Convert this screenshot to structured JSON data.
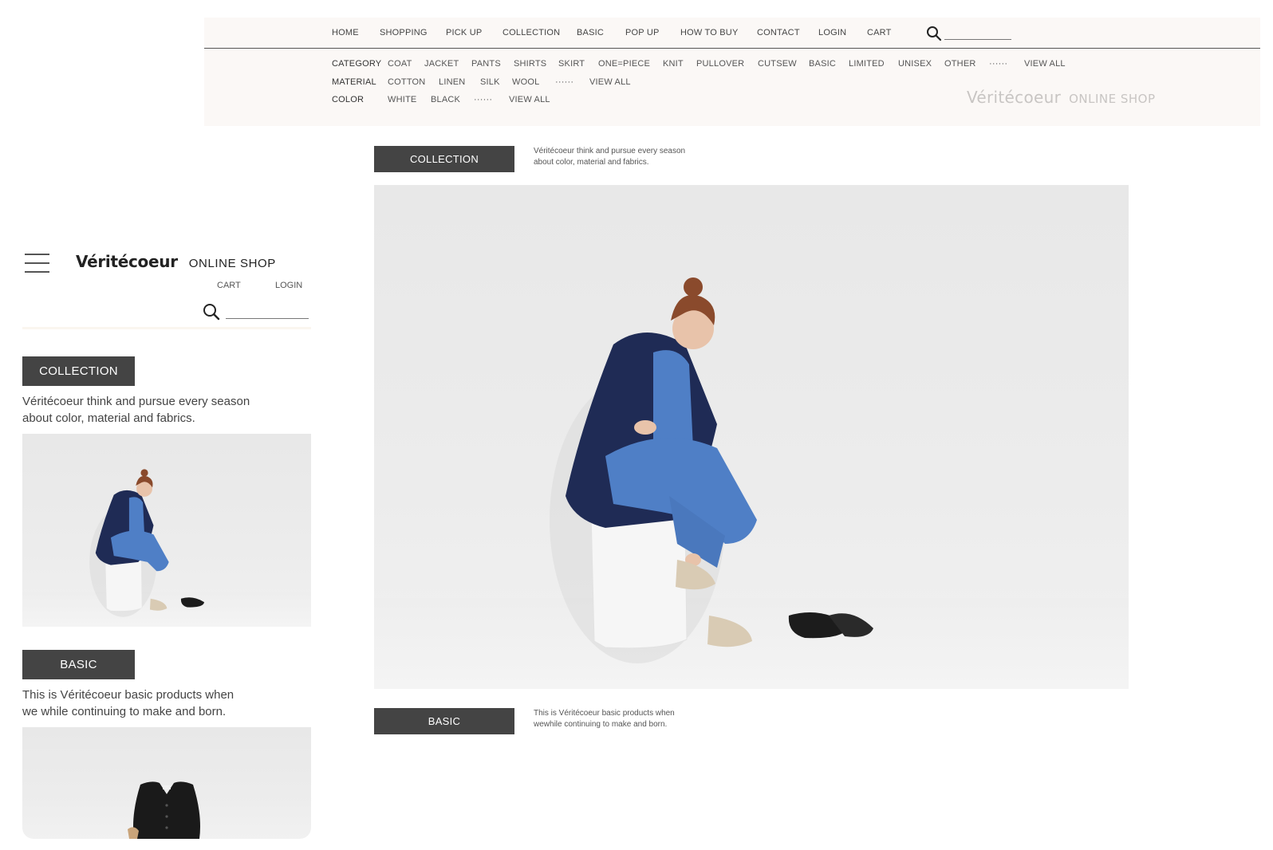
{
  "desktop": {
    "topnav": [
      {
        "label": "HOME"
      },
      {
        "label": "SHOPPING"
      },
      {
        "label": "PICK UP"
      },
      {
        "label": "COLLECTION"
      },
      {
        "label": "BASIC"
      },
      {
        "label": "POP UP"
      },
      {
        "label": "HOW TO BUY"
      },
      {
        "label": "CONTACT"
      },
      {
        "label": "LOGIN"
      },
      {
        "label": "CART"
      }
    ],
    "search": {
      "placeholder": ""
    },
    "filters": {
      "category": {
        "label": "CATEGORY",
        "items": [
          "COAT",
          "JACKET",
          "PANTS",
          "SHIRTS",
          "SKIRT",
          "ONE=PIECE",
          "KNIT",
          "PULLOVER",
          "CUTSEW",
          "BASIC",
          "LIMITED",
          "UNISEX",
          "OTHER",
          "······",
          "VIEW ALL"
        ]
      },
      "material": {
        "label": "MATERIAL",
        "items": [
          "COTTON",
          "LINEN",
          "SILK",
          "WOOL",
          "······",
          "VIEW ALL"
        ]
      },
      "color": {
        "label": "COLOR",
        "items": [
          "WHITE",
          "BLACK",
          "······",
          "VIEW ALL"
        ]
      }
    },
    "brand": {
      "name": "Véritécoeur",
      "sub": "ONLINE SHOP"
    },
    "collection": {
      "button": "COLLECTION",
      "desc_line1": "Véritécoeur think and pursue every season",
      "desc_line2": "about color, material and fabrics."
    },
    "basic": {
      "button": "BASIC",
      "desc_line1": "This is Véritécoeur basic products when",
      "desc_line2": "wewhile continuing to make and born."
    }
  },
  "mobile": {
    "brand": {
      "name": "Véritécoeur",
      "sub": "ONLINE SHOP"
    },
    "cart": "CART",
    "login": "LOGIN",
    "search": {
      "placeholder": ""
    },
    "collection": {
      "button": "COLLECTION",
      "desc_line1": "Véritécoeur think and pursue every season",
      "desc_line2": "about color, material and fabrics."
    },
    "basic": {
      "button": "BASIC",
      "desc_line1": "This is Véritécoeur basic products when",
      "desc_line2": "we while continuing to make and born."
    }
  },
  "colors": {
    "header_bg": "#fbf8f6",
    "button_bg": "#444444",
    "button_text": "#ffffff",
    "brand_light": "#c8c5c3",
    "jacket_navy": "#1f2b55",
    "jumpsuit_blue": "#4f7fc6"
  },
  "icons": {
    "search": "search-icon",
    "menu": "hamburger-menu-icon"
  }
}
